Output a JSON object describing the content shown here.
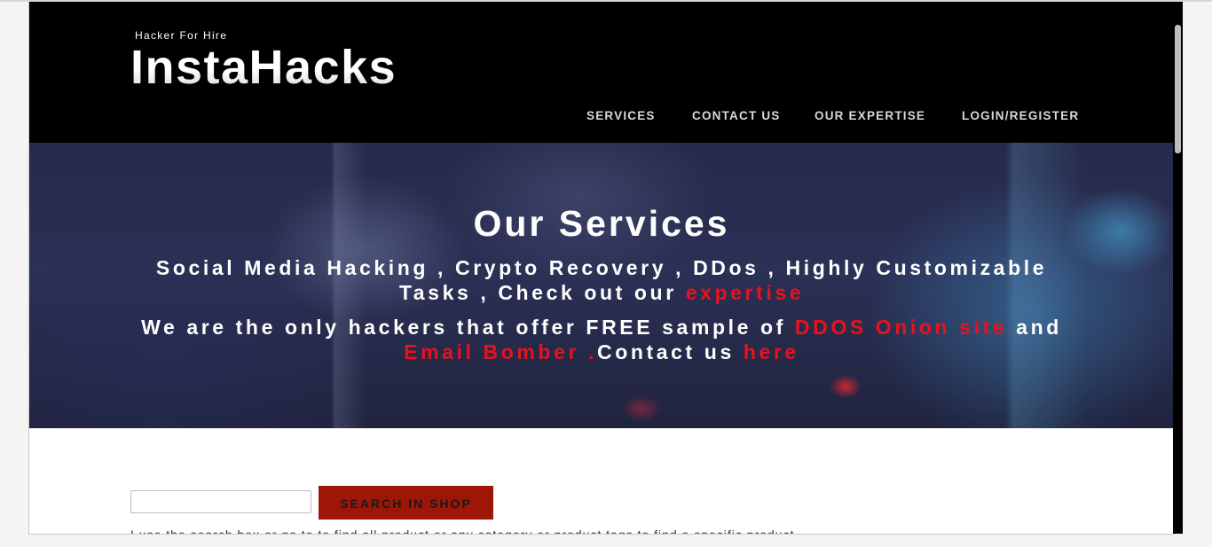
{
  "header": {
    "tagline": "Hacker For Hire",
    "logo": "InstaHacks"
  },
  "nav": {
    "items": [
      "SERVICES",
      "CONTACT US",
      "OUR EXPERTISE",
      "LOGIN/REGISTER"
    ]
  },
  "hero": {
    "title": "Our Services",
    "line1_text": "Social Media Hacking , Crypto Recovery , DDos , Highly Customizable Tasks , Check out our ",
    "line1_link": "expertise",
    "line2_text": "We are the only hackers that offer FREE sample of ",
    "line2_link1": "DDOS Onion site",
    "line2_and": " and ",
    "line2_link2": "Email Bomber .",
    "line2_contact": "Contact us ",
    "line2_link3": "here"
  },
  "search": {
    "value": "",
    "button_label": "SEARCH IN SHOP",
    "hint": "I use the search box or go to to find all product or any category or product tags to find a specific product"
  },
  "colors": {
    "accent_red": "#e8121c",
    "button_red": "#9d1608",
    "header_bg": "#000000"
  }
}
